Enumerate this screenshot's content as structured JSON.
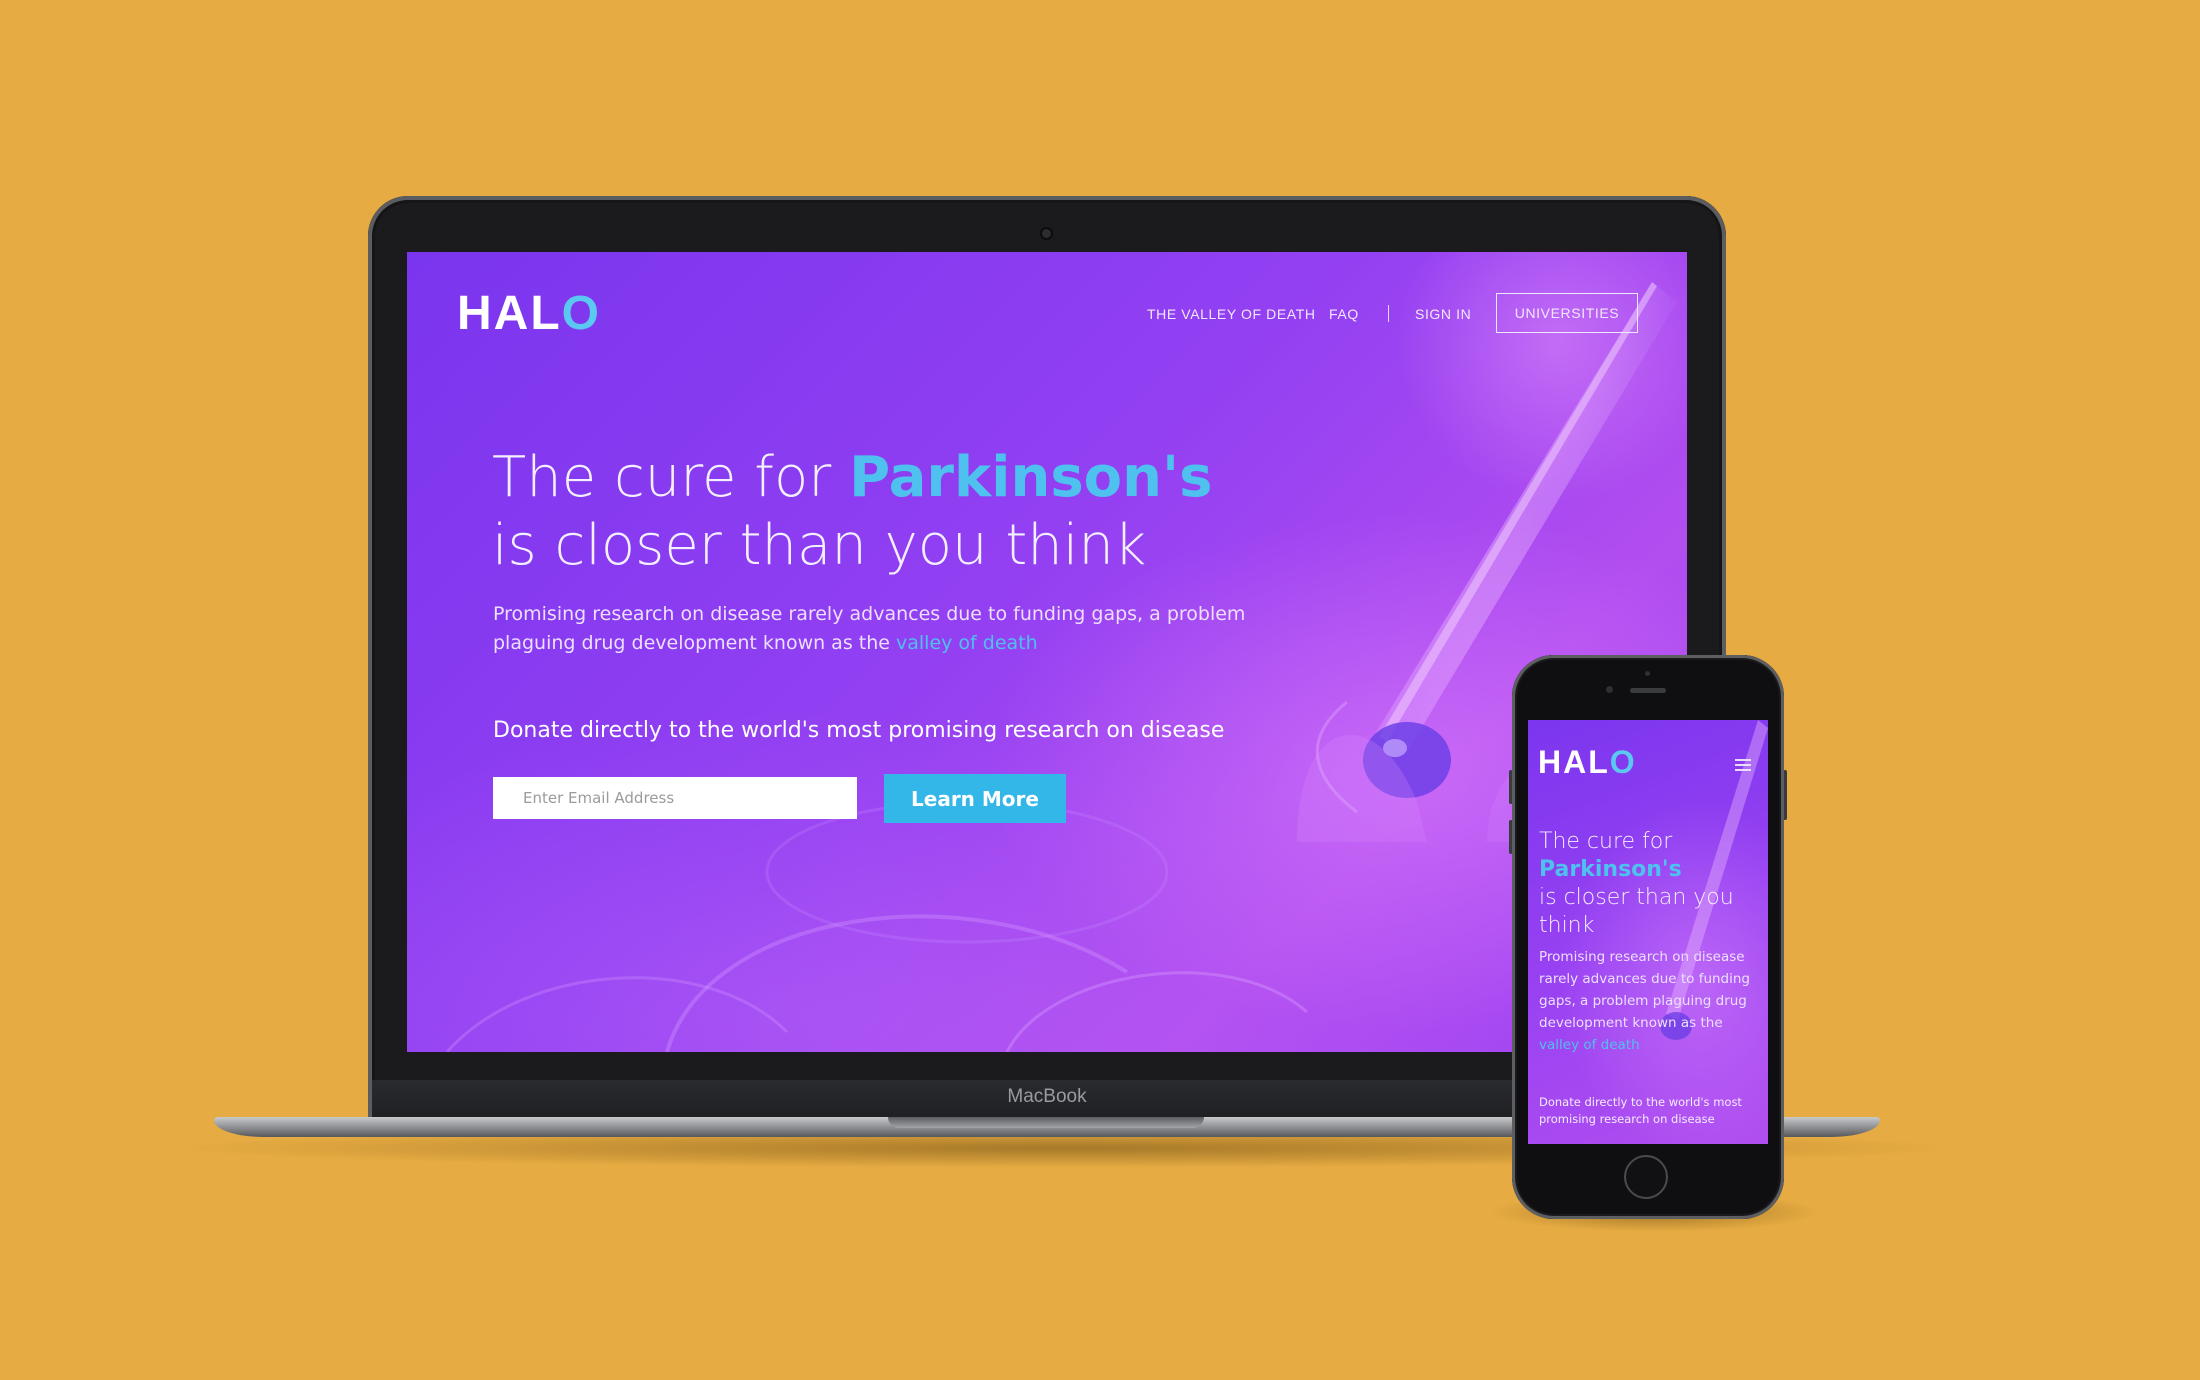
{
  "device_label": "MacBook",
  "site": {
    "logo": {
      "main": "HAL",
      "accent": "O",
      "color": "#ffffff",
      "accent_color": "#5ac8f0"
    },
    "nav": {
      "items": [
        "THE VALLEY OF DEATH",
        "FAQ",
        "SIGN IN"
      ],
      "button": "UNIVERSITIES"
    },
    "hero": {
      "headline_prefix": "The cure for",
      "headline_accent": "Parkinson's",
      "headline_suffix": "is closer than you think",
      "description": "Promising research on disease rarely advances due to funding gaps, a problem plaguing drug development known as the",
      "description_link": "valley of death",
      "cta_text": "Donate directly to the world's most promising research on disease",
      "email_placeholder": "Enter Email Address",
      "email_value": "",
      "button_label": "Learn More"
    },
    "mobile": {
      "headline_line1": "The cure for",
      "headline_accent": "Parkinson's",
      "headline_line3": "is closer than you",
      "headline_line4": "think",
      "description": "Promising research on disease rarely advances due to funding gaps, a problem plaguing drug development known as the",
      "description_link": "valley of death",
      "cta_text": "Donate directly to the world's most promising research on disease",
      "menu_icon": "hamburger-menu-icon"
    }
  },
  "colors": {
    "background": "#e6ab42",
    "hero_purple": "#8e3df0",
    "accent_blue": "#4ec1ee",
    "button_blue": "#33b6e8"
  }
}
